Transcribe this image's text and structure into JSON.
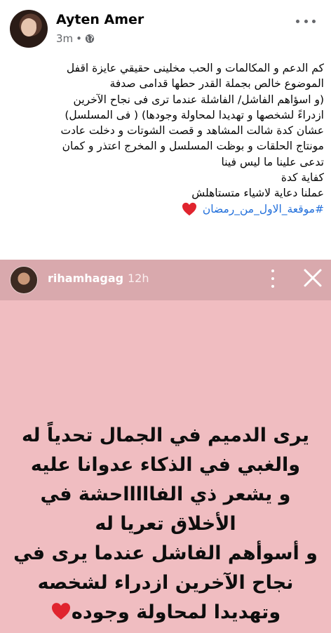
{
  "post": {
    "author": "Ayten Amer",
    "time": "3m",
    "separator": "•",
    "privacy_icon": "globe-icon",
    "more_icon": "more-horizontal-icon",
    "lines": [
      "كم الدعم و المكالمات و الحب مخلينى حقيقي عايزة اقفل",
      "الموضوع خالص بجملة القدر حطها قدامى صدفة",
      "(و اسؤاهم الفاشل/ الفاشلة عندما ترى فى نجاح الآخرين",
      "ازدراءً لشخصها و تهديدا لمحاولة وجودها) ( فى المسلسل)",
      "عشان كدة شالت المشاهد و قصت الشوتات و دخلت عادت",
      "مونتاج الحلقات و بوظت المسلسل و المخرج اعتذر  و كمان",
      "تدعى علينا ما ليس فينا",
      "كفاية كدة",
      "عملنا دعاية لاشياء متستاهلش"
    ],
    "hashtag": "#موقعة_الاول_من_رمضان",
    "heart_icon": "red-heart-icon",
    "heart_color": "#e0242e"
  },
  "story": {
    "username": "rihamhagag",
    "time": "12h",
    "close_icon": "close-icon",
    "more_icon": "more-vertical-icon",
    "background_color": "#f0bdc1",
    "lines": [
      "يرى الدميم في الجمال تحدياً له",
      "والغبي في الذكاء عدوانا عليه",
      "و  يشعر ذي الفاااااحشة في",
      "الأخلاق تعريا له",
      "و أسوأهم الفاشل عندما يرى في",
      "نجاح الآخرين ازدراء لشخصه",
      "وتهديدا لمحاولة وجوده"
    ],
    "heart_icon": "red-heart-icon"
  }
}
